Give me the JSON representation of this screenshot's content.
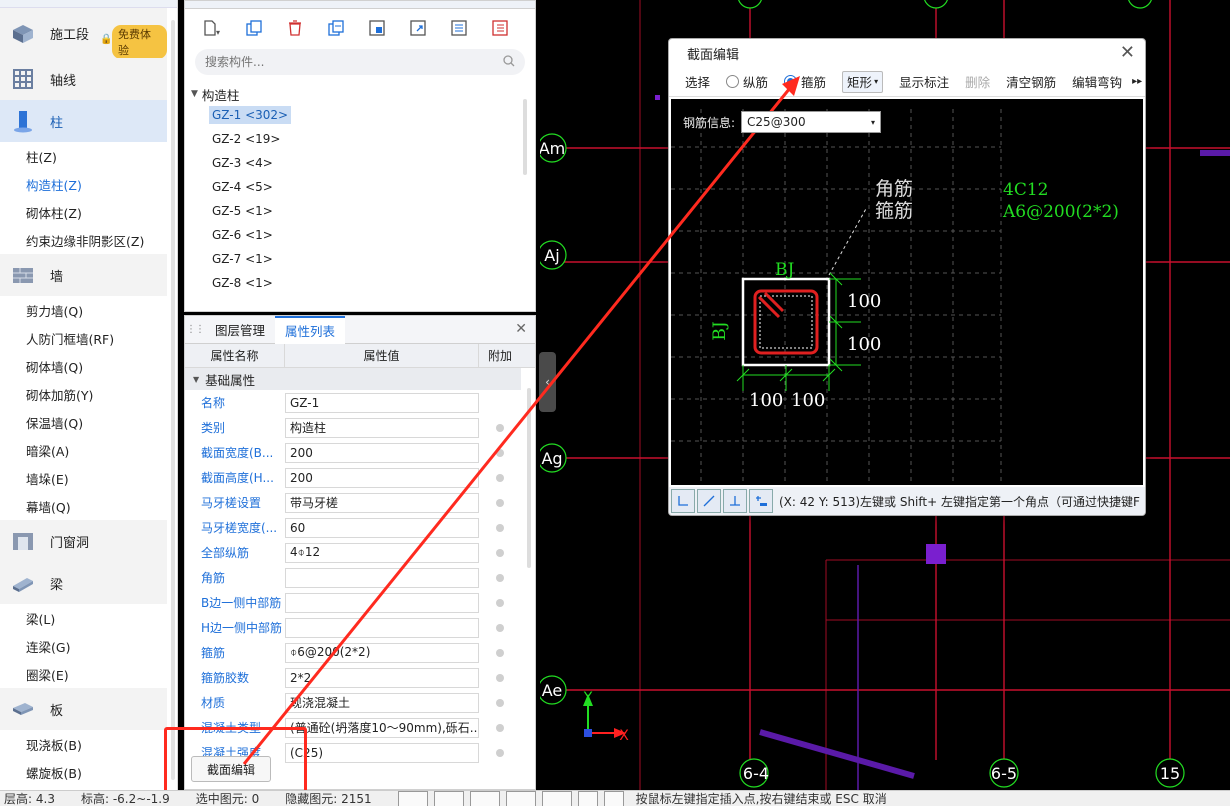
{
  "nav": {
    "free_badge": "免费体验",
    "categories": [
      {
        "label": "施工段"
      },
      {
        "label": "轴线"
      },
      {
        "label": "柱",
        "subs": [
          "柱(Z)",
          "构造柱(Z)",
          "砌体柱(Z)",
          "约束边缘非阴影区(Z)"
        ]
      },
      {
        "label": "墙",
        "subs": [
          "剪力墙(Q)",
          "人防门框墙(RF)",
          "砌体墙(Q)",
          "砌体加筋(Y)",
          "保温墙(Q)",
          "暗梁(A)",
          "墙垛(E)",
          "幕墙(Q)"
        ]
      },
      {
        "label": "门窗洞"
      },
      {
        "label": "梁",
        "subs": [
          "梁(L)",
          "连梁(G)",
          "圈梁(E)"
        ]
      },
      {
        "label": "板",
        "subs": [
          "现浇板(B)",
          "螺旋板(B)"
        ]
      }
    ]
  },
  "components": {
    "search_placeholder": "搜索构件...",
    "tree_root": "构造柱",
    "items": [
      "GZ-1 <302>",
      "GZ-2 <19>",
      "GZ-3 <4>",
      "GZ-4 <5>",
      "GZ-5 <1>",
      "GZ-6 <1>",
      "GZ-7 <1>",
      "GZ-8 <1>"
    ]
  },
  "properties": {
    "tabs": [
      "图层管理",
      "属性列表"
    ],
    "columns": [
      "属性名称",
      "属性值",
      "附加"
    ],
    "group": "基础属性",
    "rows": [
      {
        "name": "名称",
        "value": "GZ-1"
      },
      {
        "name": "类别",
        "value": "构造柱"
      },
      {
        "name": "截面宽度(B...",
        "value": "200"
      },
      {
        "name": "截面高度(H...",
        "value": "200"
      },
      {
        "name": "马牙槎设置",
        "value": "带马牙槎"
      },
      {
        "name": "马牙槎宽度(...",
        "value": "60"
      },
      {
        "name": "全部纵筋",
        "value": "4⌽12"
      },
      {
        "name": "角筋",
        "value": ""
      },
      {
        "name": "B边一侧中部筋",
        "value": ""
      },
      {
        "name": "H边一侧中部筋",
        "value": ""
      },
      {
        "name": "箍筋",
        "value": "⌽6@200(2*2)"
      },
      {
        "name": "箍筋胶数",
        "value": "2*2"
      },
      {
        "name": "材质",
        "value": "现浇混凝土"
      },
      {
        "name": "混凝土类型",
        "value": "(普通砼(坍落度10～90mm),砾石..."
      },
      {
        "name": "混凝土强度",
        "value": "(C25)"
      }
    ],
    "edit_button": "截面编辑"
  },
  "dialog": {
    "title": "截面编辑",
    "tools": {
      "select": "选择",
      "longitudinal": "纵筋",
      "stirrup": "箍筋",
      "shape": "矩形",
      "show_marks": "显示标注",
      "delete": "删除",
      "clear": "清空钢筋",
      "edit_hook": "编辑弯钩"
    },
    "rebar_label": "钢筋信息:",
    "rebar_value": "C25@300",
    "canvas": {
      "corner_label": "角筋",
      "stirrup_label": "箍筋",
      "note1": "4C12",
      "note2": "A6@200(2*2)",
      "bj_top": "BJ",
      "bj_left": "BJ",
      "dim": "100"
    },
    "status_text": "(X: 42 Y: 513)左键或 Shift+ 左键指定第一个角点（可通过快捷键F"
  },
  "cad": {
    "axes": [
      "Am",
      "Aj",
      "Ag",
      "Ae",
      "6-4",
      "6-5",
      "15"
    ],
    "y_label": "Y",
    "x_label": "X"
  },
  "status": {
    "floor_height_label": "层高:",
    "floor_height": "4.3",
    "elevation_label": "标高:",
    "elevation": "-6.2~-1.9",
    "selected_label": "选中图元:",
    "selected": "0",
    "hidden_label": "隐藏图元:",
    "hidden": "2151",
    "hint": "按鼠标左键指定插入点,按右键结束或 ESC 取消"
  },
  "colors": {
    "accent": "#1e6fd9",
    "annotation_red": "#ff2a1f",
    "cad_green": "#22dd22"
  }
}
